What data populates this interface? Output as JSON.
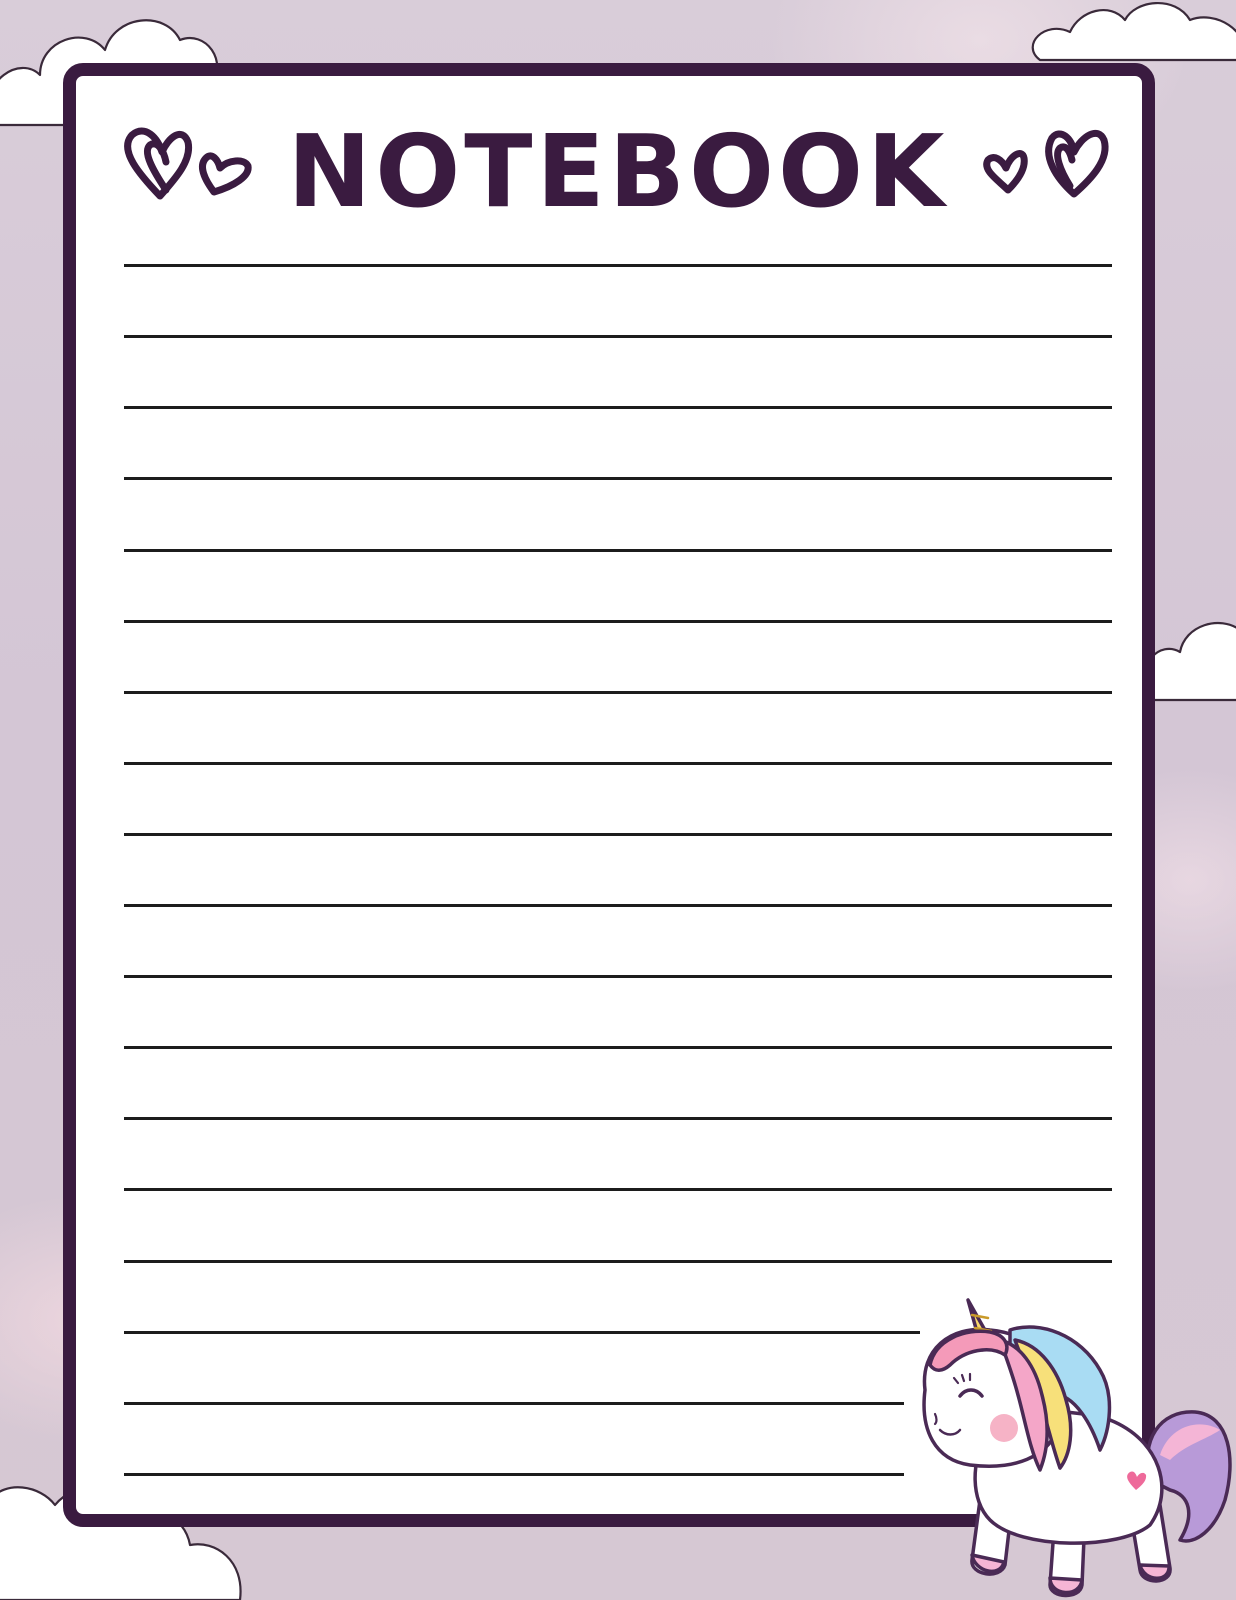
{
  "page": {
    "title": "NOTEBOOK"
  },
  "colors": {
    "border": "#3a1b40",
    "paper": "#ffffff",
    "rule": "#1c1c1c",
    "background": "#d6c9d6"
  },
  "ruled_lines": {
    "count": 18
  },
  "decorations": {
    "icons": [
      "heart-icon",
      "cloud-icon",
      "unicorn-illustration"
    ]
  }
}
